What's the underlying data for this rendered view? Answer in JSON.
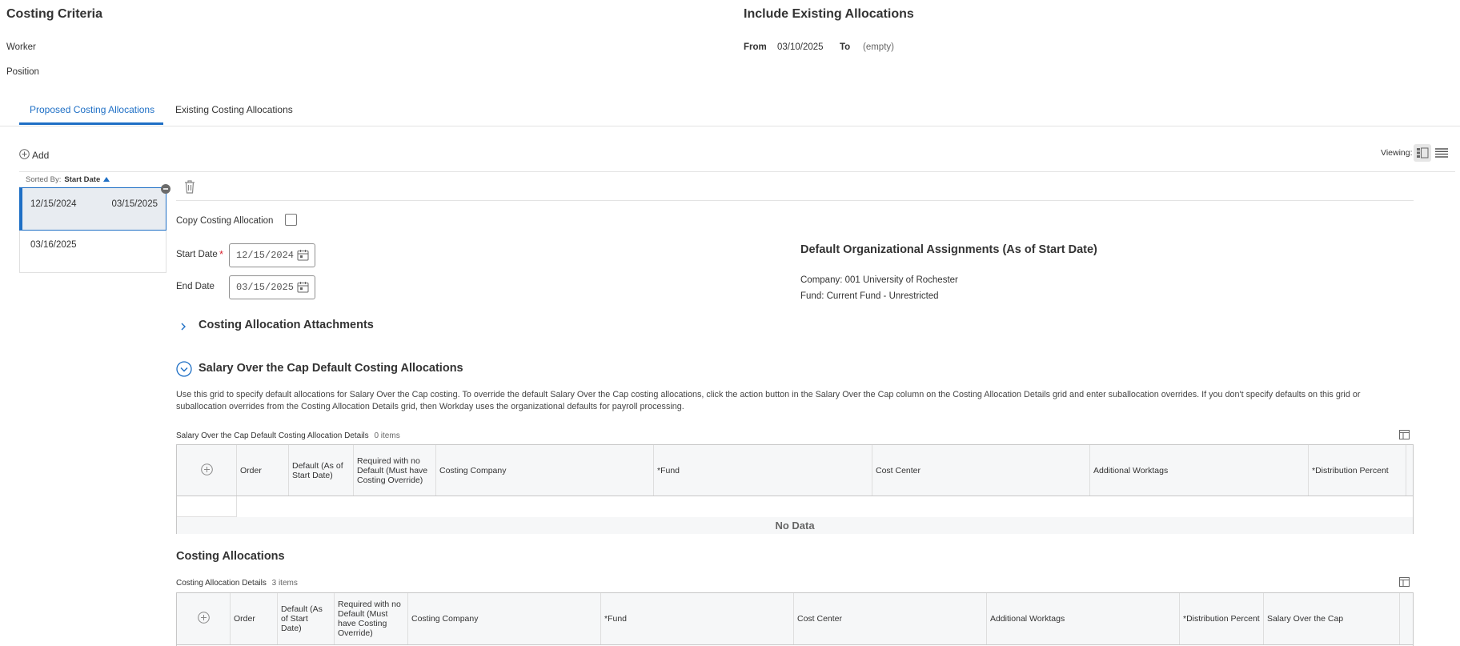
{
  "criteria": {
    "title": "Costing Criteria",
    "worker_label": "Worker",
    "position_label": "Position"
  },
  "existing": {
    "title": "Include Existing Allocations",
    "from_label": "From",
    "from_value": "03/10/2025",
    "to_label": "To",
    "to_value": "(empty)"
  },
  "tabs": [
    {
      "label": "Proposed Costing Allocations",
      "active": true
    },
    {
      "label": "Existing Costing Allocations",
      "active": false
    }
  ],
  "toolbar": {
    "add_label": "Add",
    "viewing_label": "Viewing:"
  },
  "sidebar": {
    "sorted_by_label": "Sorted By:",
    "sorted_by_value": "Start Date",
    "items": [
      {
        "start": "12/15/2024",
        "end": "03/15/2025",
        "selected": true
      },
      {
        "start": "03/16/2025",
        "end": "",
        "selected": false
      }
    ]
  },
  "form": {
    "copy_label": "Copy Costing Allocation",
    "start_label": "Start Date",
    "start_value": "12/15/2024",
    "end_label": "End Date",
    "end_value": "03/15/2025"
  },
  "defaults": {
    "title": "Default Organizational Assignments (As of Start Date)",
    "company": "Company: 001 University of Rochester",
    "fund": "Fund: Current Fund - Unrestricted"
  },
  "attachments": {
    "title": "Costing Allocation Attachments"
  },
  "salary_cap": {
    "title": "Salary Over the Cap Default Costing Allocations",
    "description": "Use this grid to specify default allocations for Salary Over the Cap costing. To override the default Salary Over the Cap costing allocations, click the action button in the Salary Over the Cap column on the Costing Allocation Details grid and enter suballocation overrides. If you don't specify defaults on this grid or suballocation overrides from the Costing Allocation Details grid, then Workday uses the organizational defaults for payroll processing.",
    "grid_title": "Salary Over the Cap Default Costing Allocation Details",
    "grid_count": "0 items",
    "columns": {
      "order": "Order",
      "default": "Default (As of Start Date)",
      "required": "Required with no Default (Must have Costing Override)",
      "company": "Costing Company",
      "fund": "*Fund",
      "cost_center": "Cost Center",
      "worktags": "Additional Worktags",
      "percent": "*Distribution Percent"
    },
    "no_data": "No Data"
  },
  "costing": {
    "title": "Costing Allocations",
    "grid_title": "Costing Allocation Details",
    "grid_count": "3 items",
    "columns": {
      "order": "Order",
      "default": "Default (As of Start Date)",
      "required": "Required with no Default (Must have Costing Override)",
      "company": "Costing Company",
      "fund": "*Fund",
      "cost_center": "Cost Center",
      "worktags": "Additional Worktags",
      "percent": "*Distribution Percent",
      "salary_cap": "Salary Over the Cap"
    }
  },
  "colors": {
    "accent": "#1e6fc5",
    "required": "#d9232e",
    "selected_bg": "#e8ecf1"
  }
}
